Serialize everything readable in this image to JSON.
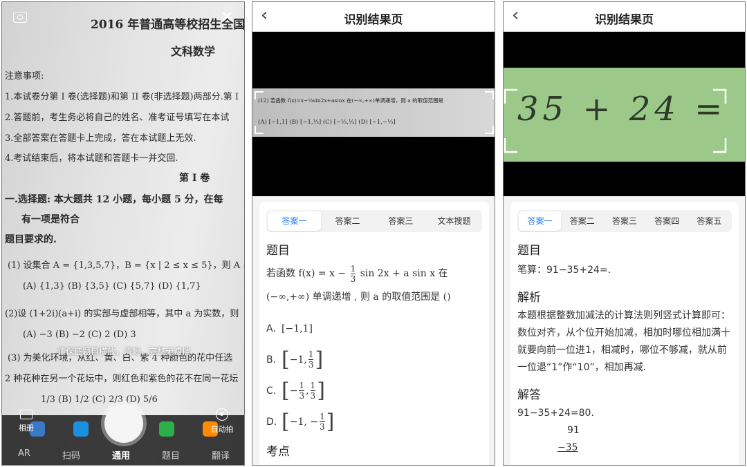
{
  "camera": {
    "paper_lines": [
      "2016 年普通高等校招生全国",
      "文科数学",
      "注意事项:",
      "1.本试卷分第 I 卷(选择题)和第 II 卷(非选择题)两部分.第 I",
      "2.答题前，考生务必将自己的姓名、准考证号填写在本试",
      "3.全部答案在答题卡上完成，答在本试题上无效.",
      "4.考试结束后，将本试题和答题卡一并交回.",
      "第 I 卷",
      "一.选择题: 本大题共 12 小题，每小题 5 分，在每",
      "有一项是符合",
      "题目要求的.",
      "(1) 设集合 A = {1,3,5,7}，B = {x | 2 ≤ x ≤ 5}，则 A ∩",
      "(A) {1,3} (B) {3,5} (C) {5,7} (D) {1,7}",
      "(2)设 (1+2i)(a+i) 的实部与虚部相等，其中 a 为实数，则",
      "(A) −3 (B) −2 (C) 2 (D) 3",
      "(3) 为美化环境，从红、黄、白、紫 4 种颜色的花中任选",
      "2 种花种在另一个花坛中，则红色和紫色的花不在同一花坛",
      "1/3 (B) 1/2 (C) 2/3 (D) 5/6"
    ],
    "hint": "请保证题目横放，清晰，完整无遮挡",
    "album_label": "相册",
    "auto_label": "自动拍",
    "modes": [
      "AR",
      "扫码",
      "通用",
      "题目",
      "翻译"
    ],
    "active_mode": "通用",
    "dock_colors": [
      "#3a78c8",
      "#1b8fe0",
      "#e64a2e",
      "#2bb04c",
      "#ff8a00"
    ]
  },
  "result1": {
    "nav_title": "识别结果页",
    "image_text_line1": "(12) 若函数 f(x)=x−⅓sin2x+asinx 在(−∞,+∞)单调递增，则 a 的取值范围是",
    "image_text_line2": "(A) [−1,1]  (B) [−1,⅓]  (C) [−⅓,⅓]  (D) [−1,−⅓]",
    "tabs": [
      "答案一",
      "答案二",
      "答案三",
      "文本搜题"
    ],
    "active_tab": "答案一",
    "section_question": "题目",
    "question_prefix": "若函数 f(x) = x −",
    "question_frac_num": "1",
    "question_frac_den": "3",
    "question_suffix": "sin 2x + a sin x   在",
    "question_line2": "(−∞,+∞) 单调递增 , 则 a 的取值范围是 ()",
    "options": [
      {
        "label": "A.",
        "text": "[−1,1]"
      },
      {
        "label": "B.",
        "text": "−1,",
        "num": "1",
        "den": "3"
      },
      {
        "label": "C.",
        "text": "−",
        "num": "1",
        "den": "3",
        "num2": "1",
        "den2": "3"
      },
      {
        "label": "D.",
        "text": "−1, −",
        "num": "1",
        "den": "3"
      }
    ],
    "section_points": "考点"
  },
  "result2": {
    "nav_title": "识别结果页",
    "image_text": "35 + 24 =",
    "tabs": [
      "答案一",
      "答案二",
      "答案三",
      "答案四",
      "答案五"
    ],
    "active_tab": "答案一",
    "section_question": "题目",
    "question": "笔算：91−35+24=.",
    "section_analysis": "解析",
    "analysis": "本题根据整数加减法的计算法则列竖式计算即可：数位对齐，从个位开始加减，相加时哪位相加满十就要向前一位进1，相减时，哪位不够减，就从前一位退“1”作“10”，相加再减.",
    "section_answer": "解答",
    "answer_line": "91−35+24=80.",
    "vertical_top": "91",
    "vertical_sub": "−35"
  },
  "colors": {
    "accent": "#2b7de9",
    "chalkboard": "#9cc98a"
  }
}
